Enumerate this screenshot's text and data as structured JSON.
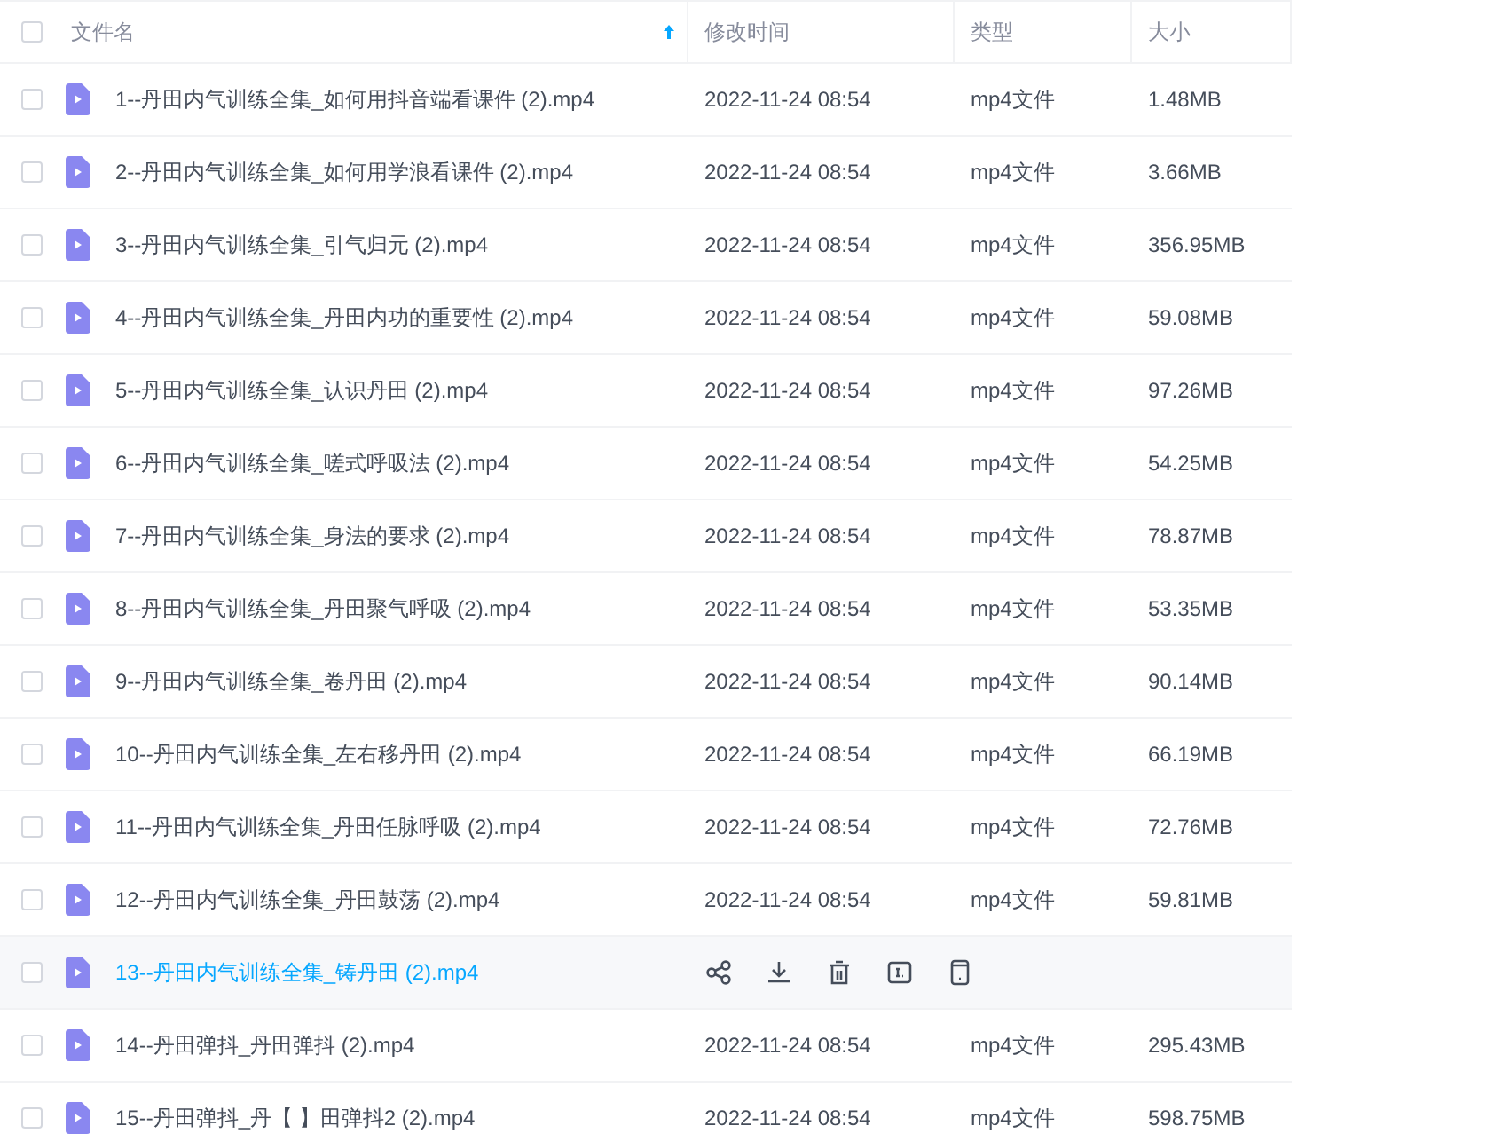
{
  "header": {
    "checked": false,
    "columns": [
      {
        "label": "文件名",
        "sorted": true
      },
      {
        "label": "修改时间",
        "sorted": false
      },
      {
        "label": "类型",
        "sorted": false
      },
      {
        "label": "大小",
        "sorted": false
      }
    ]
  },
  "rows": [
    {
      "name": "1--丹田内气训练全集_如何用抖音端看课件 (2).mp4",
      "modified": "2022-11-24 08:54",
      "type": "mp4文件",
      "size": "1.48MB",
      "checked": false,
      "hovered": false
    },
    {
      "name": "2--丹田内气训练全集_如何用学浪看课件 (2).mp4",
      "modified": "2022-11-24 08:54",
      "type": "mp4文件",
      "size": "3.66MB",
      "checked": false,
      "hovered": false
    },
    {
      "name": "3--丹田内气训练全集_引气归元 (2).mp4",
      "modified": "2022-11-24 08:54",
      "type": "mp4文件",
      "size": "356.95MB",
      "checked": false,
      "hovered": false
    },
    {
      "name": "4--丹田内气训练全集_丹田内功的重要性 (2).mp4",
      "modified": "2022-11-24 08:54",
      "type": "mp4文件",
      "size": "59.08MB",
      "checked": false,
      "hovered": false
    },
    {
      "name": "5--丹田内气训练全集_认识丹田 (2).mp4",
      "modified": "2022-11-24 08:54",
      "type": "mp4文件",
      "size": "97.26MB",
      "checked": false,
      "hovered": false
    },
    {
      "name": "6--丹田内气训练全集_嗟式呼吸法 (2).mp4",
      "modified": "2022-11-24 08:54",
      "type": "mp4文件",
      "size": "54.25MB",
      "checked": false,
      "hovered": false
    },
    {
      "name": "7--丹田内气训练全集_身法的要求 (2).mp4",
      "modified": "2022-11-24 08:54",
      "type": "mp4文件",
      "size": "78.87MB",
      "checked": false,
      "hovered": false
    },
    {
      "name": "8--丹田内气训练全集_丹田聚气呼吸 (2).mp4",
      "modified": "2022-11-24 08:54",
      "type": "mp4文件",
      "size": "53.35MB",
      "checked": false,
      "hovered": false
    },
    {
      "name": "9--丹田内气训练全集_卷丹田 (2).mp4",
      "modified": "2022-11-24 08:54",
      "type": "mp4文件",
      "size": "90.14MB",
      "checked": false,
      "hovered": false
    },
    {
      "name": "10--丹田内气训练全集_左右移丹田 (2).mp4",
      "modified": "2022-11-24 08:54",
      "type": "mp4文件",
      "size": "66.19MB",
      "checked": false,
      "hovered": false
    },
    {
      "name": "11--丹田内气训练全集_丹田任脉呼吸 (2).mp4",
      "modified": "2022-11-24 08:54",
      "type": "mp4文件",
      "size": "72.76MB",
      "checked": false,
      "hovered": false
    },
    {
      "name": "12--丹田内气训练全集_丹田鼓荡 (2).mp4",
      "modified": "2022-11-24 08:54",
      "type": "mp4文件",
      "size": "59.81MB",
      "checked": false,
      "hovered": false
    },
    {
      "name": "13--丹田内气训练全集_铸丹田 (2).mp4",
      "checked": false,
      "hovered": true
    },
    {
      "name": "14--丹田弹抖_丹田弹抖 (2).mp4",
      "modified": "2022-11-24 08:54",
      "type": "mp4文件",
      "size": "295.43MB",
      "checked": false,
      "hovered": false
    },
    {
      "name": "15--丹田弹抖_丹【 】田弹抖2 (2).mp4",
      "modified": "2022-11-24 08:54",
      "type": "mp4文件",
      "size": "598.75MB",
      "checked": false,
      "hovered": false
    }
  ]
}
